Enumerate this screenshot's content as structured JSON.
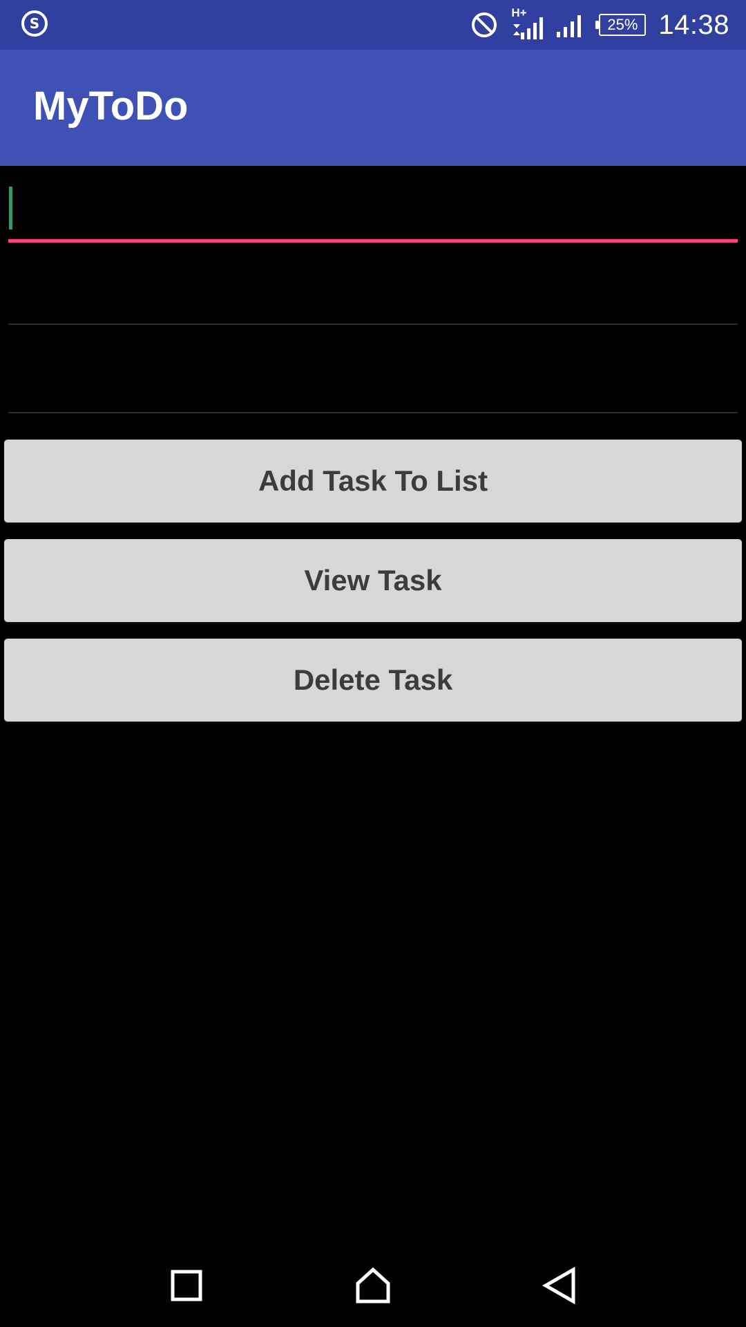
{
  "status_bar": {
    "app_indicator_letter": "S",
    "battery_percent": "25%",
    "time": "14:38",
    "network_type": "H+",
    "icons": [
      "s-app-icon",
      "do-not-disturb-icon",
      "mobile-data-h-plus-icon",
      "cell-signal-icon",
      "battery-icon"
    ]
  },
  "app_bar": {
    "title": "MyToDo"
  },
  "form": {
    "field_1": {
      "value": "",
      "placeholder": ""
    },
    "field_2": {
      "value": "",
      "placeholder": ""
    },
    "field_3": {
      "value": "",
      "placeholder": ""
    }
  },
  "buttons": {
    "add_label": "Add Task To List",
    "view_label": "View Task",
    "delete_label": "Delete Task"
  },
  "nav_bar": {
    "icons": [
      "recent-apps-icon",
      "home-icon",
      "back-icon"
    ]
  },
  "colors": {
    "status_bar": "#3140a0",
    "app_bar": "#3f51b5",
    "accent": "#ff4081",
    "cursor": "#1fa463",
    "button_bg": "#d6d7d7",
    "button_text": "#3c3c3c",
    "background": "#000000"
  }
}
